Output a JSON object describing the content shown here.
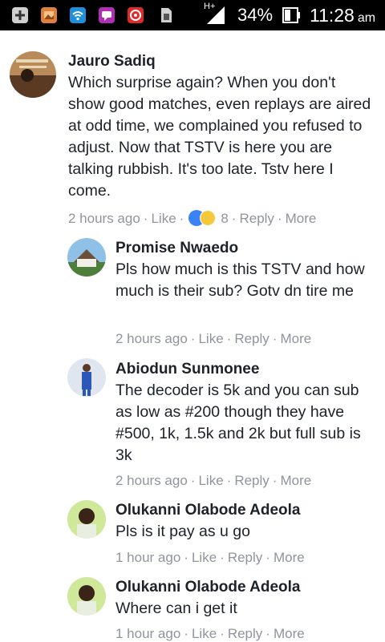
{
  "status_bar": {
    "network": "H+",
    "battery": "34%",
    "time": "11:28",
    "ampm": "am"
  },
  "comments": [
    {
      "author": "Jauro Sadiq",
      "text": "Which surprise again? When you don't show good matches, even replays are aired at odd time, we complained you refused to adjust. Now that TSTV is here you are talking rubbish. It's too late. Tstv here I come.",
      "time": "2 hours ago",
      "like": "Like",
      "reactions": "8",
      "reply": "Reply",
      "more": "More"
    },
    {
      "author": "Promise Nwaedo",
      "text": "Pls how much is this TSTV and how much is their sub? Gotv dn tire me",
      "time": "2 hours ago",
      "like": "Like",
      "reply": "Reply",
      "more": "More"
    },
    {
      "author": "Abiodun Sunmonee",
      "text": "The decoder is 5k and you can sub as low as #200 though they have #500, 1k, 1.5k and 2k but full sub is 3k",
      "time": "2 hours ago",
      "like": "Like",
      "reply": "Reply",
      "more": "More"
    },
    {
      "author": "Olukanni Olabode Adeola",
      "text": "Pls is it pay as u go",
      "time": "1 hour ago",
      "like": "Like",
      "reply": "Reply",
      "more": "More"
    },
    {
      "author": "Olukanni Olabode Adeola",
      "text": "Where can i get it",
      "time": "1 hour ago",
      "like": "Like",
      "reply": "Reply",
      "more": "More"
    }
  ]
}
